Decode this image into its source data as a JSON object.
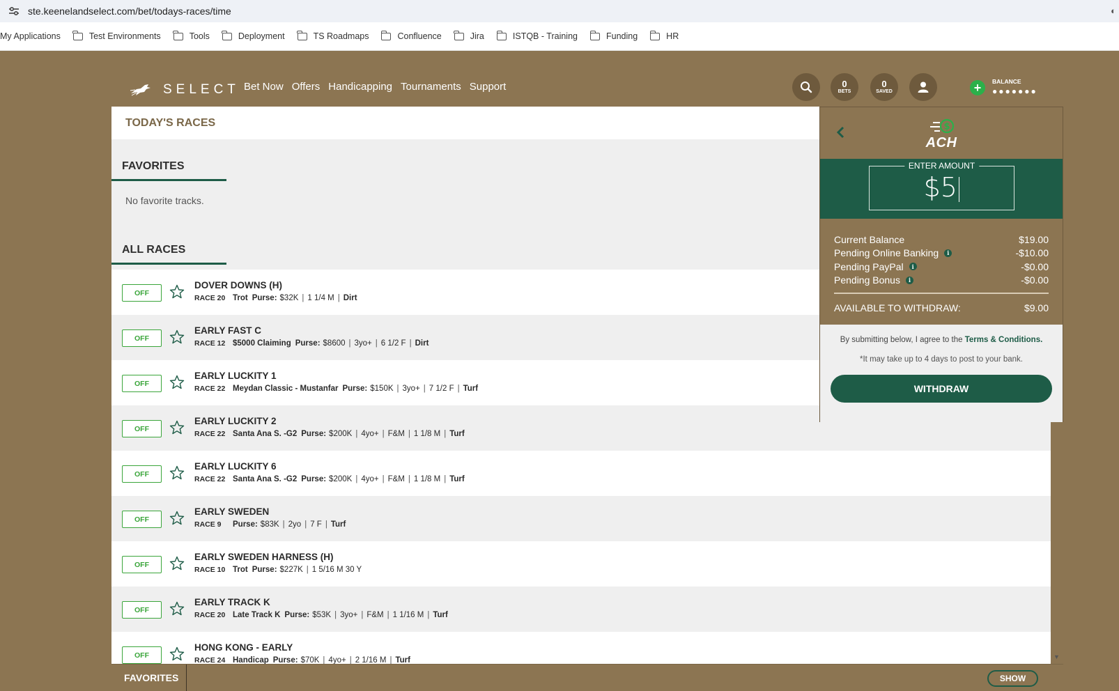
{
  "browser": {
    "url": "ste.keenelandselect.com/bet/todays-races/time",
    "bookmarks": [
      {
        "label": "My Applications",
        "folder": false
      },
      {
        "label": "Test Environments",
        "folder": true
      },
      {
        "label": "Tools",
        "folder": true
      },
      {
        "label": "Deployment",
        "folder": true
      },
      {
        "label": "TS Roadmaps",
        "folder": true
      },
      {
        "label": "Confluence",
        "folder": true
      },
      {
        "label": "Jira",
        "folder": true
      },
      {
        "label": "ISTQB - Training",
        "folder": true
      },
      {
        "label": "Funding",
        "folder": true
      },
      {
        "label": "HR",
        "folder": true
      }
    ]
  },
  "header": {
    "logo_text": "SELECT",
    "nav": [
      "Bet Now",
      "Offers",
      "Handicapping",
      "Tournaments",
      "Support"
    ],
    "bets_count": "0",
    "bets_label": "BETS",
    "saved_count": "0",
    "saved_label": "SAVED",
    "balance_label": "BALANCE",
    "balance_masked": "●●●●●●●"
  },
  "page": {
    "title": "TODAY'S RACES",
    "favorites_title": "FAVORITES",
    "no_favorites": "No favorite tracks.",
    "all_races_title": "ALL RACES"
  },
  "races": [
    {
      "status": "OFF",
      "name": "DOVER DOWNS (H)",
      "race": "RACE 20",
      "type": "Trot",
      "purpose_label": "Purse:",
      "purse": "$32K",
      "details": [
        "1 1/4 M"
      ],
      "surface": "Dirt"
    },
    {
      "status": "OFF",
      "name": "EARLY FAST C",
      "race": "RACE 12",
      "type": "$5000 Claiming",
      "purpose_label": "Purse:",
      "purse": "$8600",
      "details": [
        "3yo+",
        "6 1/2 F"
      ],
      "surface": "Dirt"
    },
    {
      "status": "OFF",
      "name": "EARLY LUCKITY 1",
      "race": "RACE 22",
      "type": "Meydan Classic - Mustanfar",
      "purpose_label": "Purse:",
      "purse": "$150K",
      "details": [
        "3yo+",
        "7 1/2 F"
      ],
      "surface": "Turf"
    },
    {
      "status": "OFF",
      "name": "EARLY LUCKITY 2",
      "race": "RACE 22",
      "type": "Santa Ana S. -G2",
      "purpose_label": "Purse:",
      "purse": "$200K",
      "details": [
        "4yo+",
        "F&M",
        "1 1/8 M"
      ],
      "surface": "Turf"
    },
    {
      "status": "OFF",
      "name": "EARLY LUCKITY 6",
      "race": "RACE 22",
      "type": "Santa Ana S. -G2",
      "purpose_label": "Purse:",
      "purse": "$200K",
      "details": [
        "4yo+",
        "F&M",
        "1 1/8 M"
      ],
      "surface": "Turf"
    },
    {
      "status": "OFF",
      "name": "EARLY SWEDEN",
      "race": "RACE 9",
      "type": "",
      "purpose_label": "Purse:",
      "purse": "$83K",
      "details": [
        "2yo",
        "7 F"
      ],
      "surface": "Turf"
    },
    {
      "status": "OFF",
      "name": "EARLY SWEDEN HARNESS (H)",
      "race": "RACE 10",
      "type": "Trot",
      "purpose_label": "Purse:",
      "purse": "$227K",
      "details": [
        "1 5/16 M 30 Y"
      ],
      "surface": ""
    },
    {
      "status": "OFF",
      "name": "EARLY TRACK K",
      "race": "RACE 20",
      "type": "Late Track K",
      "purpose_label": "Purse:",
      "purse": "$53K",
      "details": [
        "3yo+",
        "F&M",
        "1 1/16 M"
      ],
      "surface": "Turf"
    },
    {
      "status": "OFF",
      "name": "HONG KONG - EARLY",
      "race": "RACE 24",
      "type": "Handicap",
      "purpose_label": "Purse:",
      "purse": "$70K",
      "details": [
        "4yo+",
        "2 1/16 M"
      ],
      "surface": "Turf"
    }
  ],
  "withdraw_panel": {
    "method": "ACH",
    "amount_label": "ENTER AMOUNT",
    "amount_value": "$5",
    "balances": [
      {
        "label": "Current Balance",
        "value": "$19.00",
        "info": false
      },
      {
        "label": "Pending Online Banking",
        "value": "-$10.00",
        "info": true
      },
      {
        "label": "Pending PayPal",
        "value": "-$0.00",
        "info": true
      },
      {
        "label": "Pending Bonus",
        "value": "-$0.00",
        "info": true
      }
    ],
    "available_label": "AVAILABLE TO WITHDRAW:",
    "available_value": "$9.00",
    "terms_prefix": "By submitting below, I agree to the ",
    "terms_link": "Terms & Conditions.",
    "note": "*It may take up to 4 days to post to your bank.",
    "withdraw_label": "WITHDRAW"
  },
  "bottom_bar": {
    "favorites_label": "FAVORITES",
    "show_label": "SHOW"
  },
  "colors": {
    "brand_brown": "#8c7552",
    "brand_green": "#1e5c47",
    "status_green": "#3aa53a",
    "add_funds_green": "#2bb04a"
  }
}
